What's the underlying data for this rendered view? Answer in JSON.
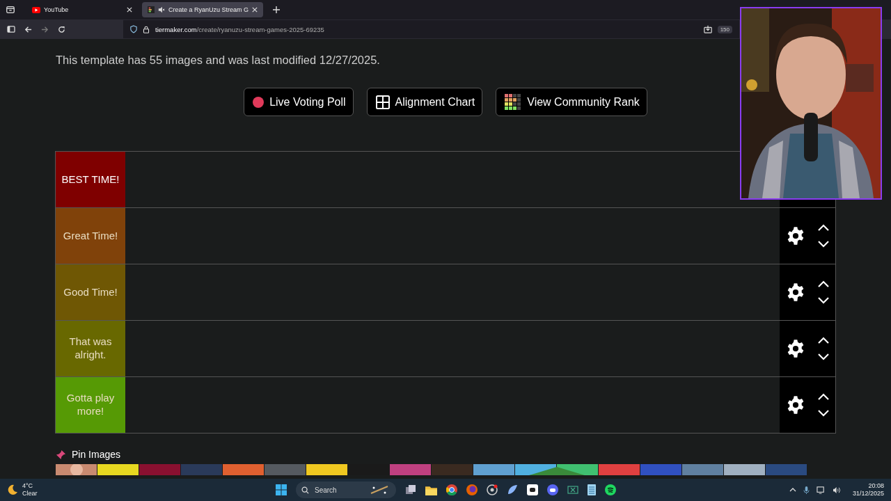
{
  "browser": {
    "tabs": [
      {
        "title": "YouTube",
        "selected": false
      },
      {
        "title": "Create a RyanUzu Stream G",
        "selected": true
      }
    ],
    "url_host": "tiermaker.com",
    "url_path": "/create/ryanuzu-stream-games-2025-69235",
    "zoom": "150"
  },
  "intro": "This template has 55 images and was last modified 12/27/2025.",
  "actions": [
    {
      "kind": "poll",
      "label": "Live Voting Poll"
    },
    {
      "kind": "alignment",
      "label": "Alignment Chart"
    },
    {
      "kind": "rank",
      "label": "View Community Rank"
    }
  ],
  "tiers": [
    {
      "label": "BEST TIME!",
      "color": "#7f0000"
    },
    {
      "label": "Great Time!",
      "color": "#80420a"
    },
    {
      "label": "Good Time!",
      "color": "#6f5704"
    },
    {
      "label": "That was alright.",
      "color": "#686800"
    },
    {
      "label": "Gotta play more!",
      "color": "#569a05"
    }
  ],
  "pin_images": {
    "label": "Pin Images"
  },
  "taskbar": {
    "temperature": "4°C",
    "weather": "Clear",
    "search": "Search",
    "time": "20:08",
    "date": "31/12/2025"
  }
}
